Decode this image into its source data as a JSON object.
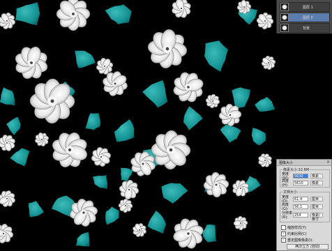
{
  "colors": {
    "background": "#000000",
    "teal": "#1aa3a3",
    "petal": "#f2f2f2",
    "panel": "#4a4a4a",
    "selection": "#5b7cac"
  },
  "layers_panel": {
    "layers": [
      {
        "name": "图层 1",
        "thumb_icon": "flower-pattern-thumbnail-icon"
      },
      {
        "name": "图层 0",
        "thumb_icon": "flower-pattern-thumbnail-icon"
      },
      {
        "name": "背景",
        "thumb_icon": "flower-pattern-thumbnail-icon"
      }
    ]
  },
  "image_size_dialog": {
    "title": "图像大小",
    "close_icon": "×",
    "pixel_group": {
      "legend": "像素大小:32.8M",
      "width_label": "宽度(W):",
      "width_value": "5630",
      "height_label": "高度(H):",
      "height_value": "5610",
      "unit": "像素"
    },
    "doc_group": {
      "legend": "文档大小:",
      "width_label": "宽度(D):",
      "width_value": "61.4",
      "height_label": "高度(G):",
      "height_value": "56.1",
      "resolution_label": "分辨率(R):",
      "resolution_value": "254",
      "unit_cm": "厘米",
      "unit_res": "像素/英寸"
    },
    "options": [
      {
        "label": "缩放样式(Y)",
        "checked": false
      },
      {
        "label": "约束比例(C)",
        "checked": true
      },
      {
        "label": "重定图像像素(I):",
        "checked": true
      }
    ],
    "resample_value": "两次立方 (自动)"
  }
}
